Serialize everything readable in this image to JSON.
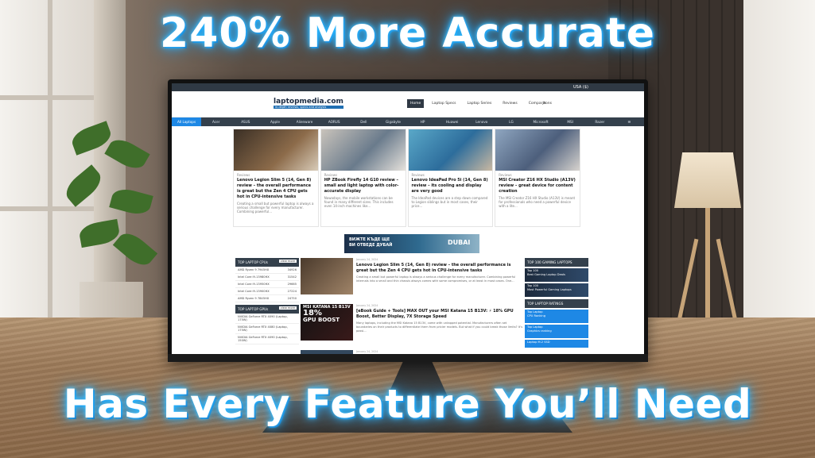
{
  "headline_top": "240% More Accurate",
  "headline_bottom": "Has Every Feature You’ll Need",
  "screen": {
    "locale": "USA ($)",
    "logo": "laptopmedia.com",
    "logo_tagline": "in-depth reviews, specs and analysis",
    "nav": [
      "Home",
      "Laptop Specs",
      "Laptop Series",
      "Reviews",
      "Comparisons"
    ],
    "brands": [
      "All Laptops",
      "Acer",
      "ASUS",
      "Apple",
      "Alienware",
      "AORUS",
      "Dell",
      "Gigabyte",
      "HP",
      "Huawei",
      "Lenovo",
      "LG",
      "Microsoft",
      "MSI",
      "Razer"
    ],
    "cards": [
      {
        "tag": "Reviews",
        "title": "Lenovo Legion Slim 5 (14, Gen 8) review – the overall performance is great but the Zen 4 CPU gets hot in CPU-intensive tasks",
        "desc": "Creating a small but powerful laptop is always a serious challenge for every manufacturer. Combining powerful..."
      },
      {
        "tag": "Reviews",
        "title": "HP ZBook Firefly 14 G10 review – small and light laptop with color-accurate display",
        "desc": "Nowadays, the mobile workstations can be found in many different sizes. This includes even 14-inch machines like..."
      },
      {
        "tag": "Reviews",
        "title": "Lenovo IdeaPad Pro 5i (14, Gen 8) review – its cooling and display are very good",
        "desc": "The IdeaPad devices are a step down compared to Legion siblings but in most cases, their price..."
      },
      {
        "tag": "Reviews",
        "title": "MSI Creator Z16 HX Studio (A13V) review – great device for content creation",
        "desc": "The MSI Creator Z16 HX Studio (A13V) is meant for professionals who need a powerful device with a lite..."
      }
    ],
    "ad_text": [
      "ВИЖТЕ КЪДЕ ЩЕ",
      "ВИ ОТВЕДЕ ДУБАЙ"
    ],
    "ad_brand": "DUBAI",
    "cpu_header": "TOP LAPTOP CPUs",
    "cpus": [
      {
        "name": "AMD Ryzen 9 7945HX",
        "score": "34926"
      },
      {
        "name": "Intel Core i9-13980HX",
        "score": "31542"
      },
      {
        "name": "Intel Core i9-13950HX",
        "score": "29665"
      },
      {
        "name": "Intel Core i9-13900HX",
        "score": "27224"
      },
      {
        "name": "AMD Ryzen 9 7845HX",
        "score": "24750"
      }
    ],
    "gpu_header": "TOP LAPTOP GPUs",
    "gpus": [
      {
        "name": "NVIDIA GeForce RTX 4090 (Laptop, 175W)"
      },
      {
        "name": "NVIDIA GeForce RTX 4080 (Laptop, 175W)"
      },
      {
        "name": "NVIDIA GeForce RTX 4090 (Laptop, 150W)"
      }
    ],
    "view_more": "view more",
    "articles": [
      {
        "date": "January 24, 2024",
        "title": "Lenovo Legion Slim 5 (14, Gen 8) review – the overall performance is great but the Zen 4 CPU gets hot in CPU-intensive tasks",
        "desc": "Creating a small but powerful laptop is always a serious challenge for every manufacturer. Combining powerful internals into a small and thin chassis always comes with some compromises, or at least in most cases. One..."
      },
      {
        "date": "January 24, 2024",
        "title": "[eBook Guide + Tools] MAX OUT your MSI Katana 15 B13V: ⚡ 18% GPU Boost, Better Display, 7X Storage Speed",
        "desc": "Many laptops, including the MSI Katana 15 B13V, come with untapped potential. Manufacturers often set boundaries on their products to differentiate them from pricier models. But what if you could break those limits? It’s possi..."
      },
      {
        "date": "January 24, 2024",
        "title": "",
        "desc": ""
      }
    ],
    "thumb2_text": [
      "MSI",
      "KATANA 15 B13V",
      "18%",
      "GPU BOOST"
    ],
    "gaming_header": "TOP 100 GAMING LAPTOPS",
    "gaming": [
      {
        "line1": "Top 100",
        "line2": "Best Gaming Laptop Deals"
      },
      {
        "line1": "Top 100",
        "line2": "Most Powerful Gaming Laptops"
      }
    ],
    "ratings_header": "TOP LAPTOP RATINGS",
    "ratings": [
      {
        "line1": "Top Laptop",
        "line2": "CPU Ranking"
      },
      {
        "line1": "Top Laptop",
        "line2": "Graphics ranking"
      },
      {
        "line1": "Laptop M.2 SSD",
        "line2": ""
      }
    ]
  }
}
